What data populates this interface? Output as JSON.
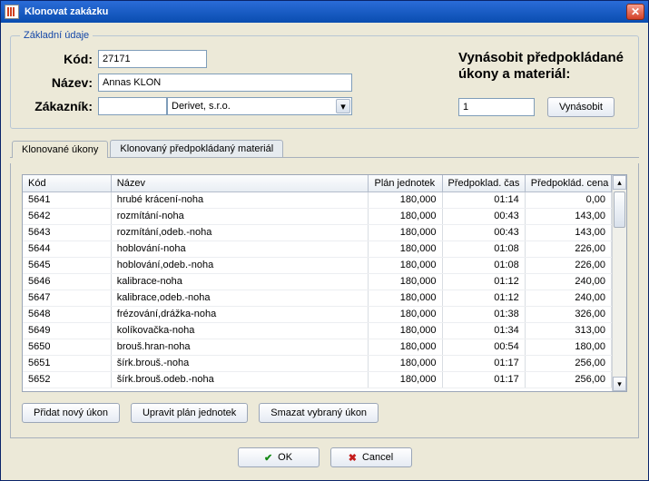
{
  "window": {
    "title": "Klonovat zakázku"
  },
  "group": {
    "legend": "Základní údaje",
    "labels": {
      "kod": "Kód:",
      "nazev": "Název:",
      "zakaznik": "Zákazník:"
    },
    "values": {
      "kod": "27171",
      "nazev": "Annas KLON",
      "zakaznik_id": "",
      "zakaznik_name": "Derivet, s.r.o."
    },
    "multiply": {
      "title_line1": "Vynásobit předpokládané",
      "title_line2": "úkony a materiál:",
      "value": "1",
      "button": "Vynásobit"
    }
  },
  "tabs": {
    "items": [
      {
        "label": "Klonované úkony",
        "active": true
      },
      {
        "label": "Klonovaný předpokládaný materiál",
        "active": false
      }
    ]
  },
  "table": {
    "columns": {
      "kod": "Kód",
      "nazev": "Název",
      "plan": "Plán jednotek",
      "cas": "Předpoklad. čas",
      "cena": "Předpoklád. cena"
    },
    "rows": [
      {
        "kod": "5641",
        "nazev": "hrubé krácení-noha",
        "plan": "180,000",
        "cas": "01:14",
        "cena": "0,00"
      },
      {
        "kod": "5642",
        "nazev": "rozmítání-noha",
        "plan": "180,000",
        "cas": "00:43",
        "cena": "143,00"
      },
      {
        "kod": "5643",
        "nazev": "rozmítání,odeb.-noha",
        "plan": "180,000",
        "cas": "00:43",
        "cena": "143,00"
      },
      {
        "kod": "5644",
        "nazev": "hoblování-noha",
        "plan": "180,000",
        "cas": "01:08",
        "cena": "226,00"
      },
      {
        "kod": "5645",
        "nazev": "hoblování,odeb.-noha",
        "plan": "180,000",
        "cas": "01:08",
        "cena": "226,00"
      },
      {
        "kod": "5646",
        "nazev": "kalibrace-noha",
        "plan": "180,000",
        "cas": "01:12",
        "cena": "240,00"
      },
      {
        "kod": "5647",
        "nazev": "kalibrace,odeb.-noha",
        "plan": "180,000",
        "cas": "01:12",
        "cena": "240,00"
      },
      {
        "kod": "5648",
        "nazev": "frézování,drážka-noha",
        "plan": "180,000",
        "cas": "01:38",
        "cena": "326,00"
      },
      {
        "kod": "5649",
        "nazev": "kolíkovačka-noha",
        "plan": "180,000",
        "cas": "01:34",
        "cena": "313,00"
      },
      {
        "kod": "5650",
        "nazev": "brouš.hran-noha",
        "plan": "180,000",
        "cas": "00:54",
        "cena": "180,00"
      },
      {
        "kod": "5651",
        "nazev": "šírk.brouš.-noha",
        "plan": "180,000",
        "cas": "01:17",
        "cena": "256,00"
      },
      {
        "kod": "5652",
        "nazev": "šírk.brouš.odeb.-noha",
        "plan": "180,000",
        "cas": "01:17",
        "cena": "256,00"
      }
    ]
  },
  "buttons": {
    "add": "Přidat nový úkon",
    "edit_plan": "Upravit plán jednotek",
    "delete": "Smazat vybraný úkon",
    "ok": "OK",
    "cancel": "Cancel"
  },
  "icons": {
    "check_glyph": "✔",
    "x_glyph": "✖",
    "close_glyph": "✕",
    "down_glyph": "▾",
    "up_glyph": "▴"
  }
}
